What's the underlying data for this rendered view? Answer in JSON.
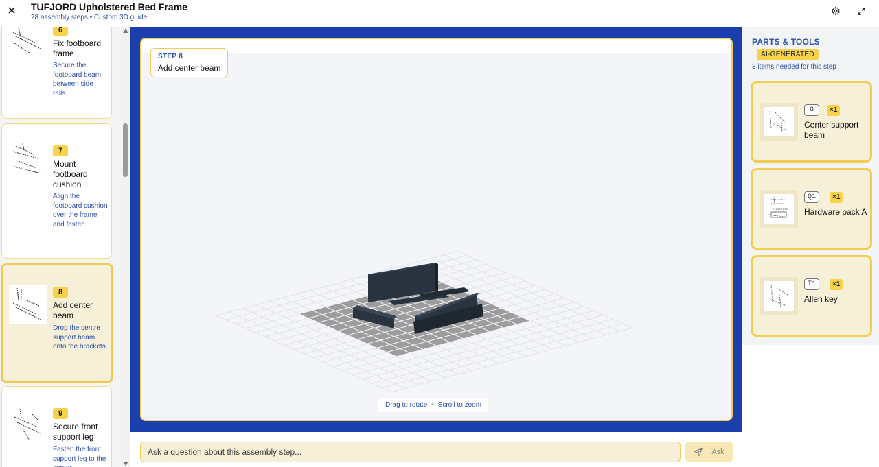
{
  "header": {
    "title": "TUFJORD Upholstered Bed Frame",
    "subtitle": "28 assembly steps • Custom 3D guide"
  },
  "steps": [
    {
      "num": "6",
      "title": "Fix footboard frame",
      "desc": "Secure the footboard beam between side rails."
    },
    {
      "num": "7",
      "title": "Mount footboard cushion",
      "desc": "Align the footboard cushion over the frame and fasten."
    },
    {
      "num": "8",
      "title": "Add center beam",
      "desc": "Drop the centre support beam onto the brackets.",
      "active": true
    },
    {
      "num": "9",
      "title": "Secure front support leg",
      "desc": "Fasten the front support leg to the center"
    }
  ],
  "viewer": {
    "step_label": "STEP 8",
    "step_title": "Add center beam",
    "hint_rotate": "Drag to rotate",
    "hint_sep": "•",
    "hint_zoom": "Scroll to zoom"
  },
  "ask": {
    "placeholder": "Ask a question about this assembly step...",
    "button": "Ask"
  },
  "parts": {
    "title": "PARTS & TOOLS",
    "badge": "AI-GENERATED",
    "count_text": "3 items needed for this step",
    "items": [
      {
        "code": "G",
        "qty": "×1",
        "name": "Center support beam"
      },
      {
        "code": "Q1",
        "qty": "×1",
        "name": "Hardware pack A"
      },
      {
        "code": "T1",
        "qty": "×1",
        "name": "Allen key"
      }
    ]
  },
  "colors": {
    "accent_blue": "#1c3fae",
    "accent_yellow": "#f8d34a",
    "link_blue": "#2c4fa8"
  }
}
